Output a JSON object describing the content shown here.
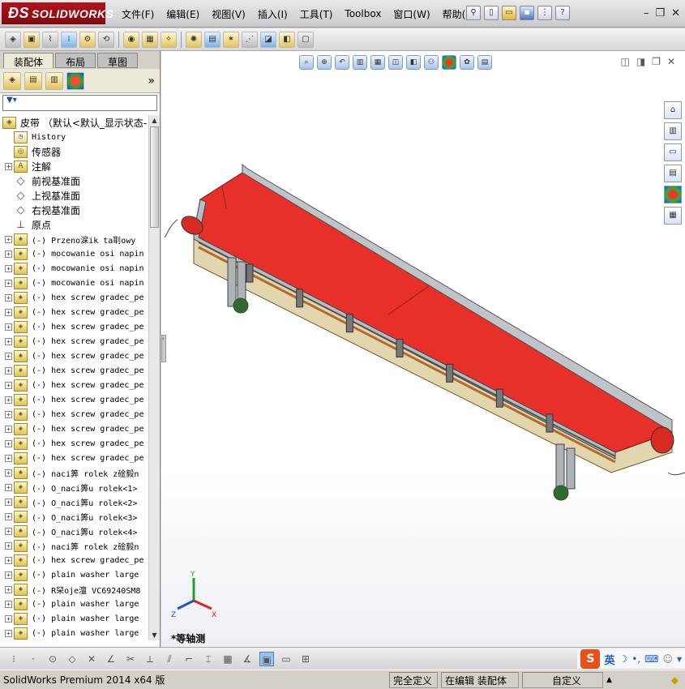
{
  "app": {
    "logo_mark": "ƉS",
    "logo_text": "SOLIDWORKS"
  },
  "menu": [
    "文件(F)",
    "编辑(E)",
    "视图(V)",
    "插入(I)",
    "工具(T)",
    "Toolbox",
    "窗口(W)",
    "帮助(H)"
  ],
  "panel": {
    "tabs": [
      "装配体",
      "布局",
      "草图"
    ],
    "active_tab": "装配体",
    "filter_icon": "funnel-icon",
    "root_label": "皮带 （默认<默认_显示状态-",
    "tree": [
      {
        "label": "History",
        "icon": "history-icon",
        "expand": false
      },
      {
        "label": "传感器",
        "icon": "sensor-icon",
        "expand": false,
        "cjk": true
      },
      {
        "label": "注解",
        "icon": "annotation-icon",
        "expand": true,
        "cjk": true
      },
      {
        "label": "前视基准面",
        "icon": "plane-icon",
        "expand": false,
        "cjk": true
      },
      {
        "label": "上视基准面",
        "icon": "plane-icon",
        "expand": false,
        "cjk": true
      },
      {
        "label": "右视基准面",
        "icon": "plane-icon",
        "expand": false,
        "cjk": true
      },
      {
        "label": "原点",
        "icon": "origin-icon",
        "expand": false,
        "cjk": true
      },
      {
        "label": "(-) Przeno淭ik ta刵owy",
        "icon": "part-icon",
        "expand": true
      },
      {
        "label": "(-) mocowanie osi napin",
        "icon": "part-icon",
        "expand": true
      },
      {
        "label": "(-) mocowanie osi napin",
        "icon": "part-icon",
        "expand": true
      },
      {
        "label": "(-) mocowanie osi napin",
        "icon": "part-icon",
        "expand": true
      },
      {
        "label": "(-) hex screw gradec_pe",
        "icon": "part-icon",
        "expand": true
      },
      {
        "label": "(-) hex screw gradec_pe",
        "icon": "part-icon",
        "expand": true
      },
      {
        "label": "(-) hex screw gradec_pe",
        "icon": "part-icon",
        "expand": true
      },
      {
        "label": "(-) hex screw gradec_pe",
        "icon": "part-icon",
        "expand": true
      },
      {
        "label": "(-) hex screw gradec_pe",
        "icon": "part-icon",
        "expand": true
      },
      {
        "label": "(-) hex screw gradec_pe",
        "icon": "part-icon",
        "expand": true
      },
      {
        "label": "(-) hex screw gradec_pe",
        "icon": "part-icon",
        "expand": true
      },
      {
        "label": "(-) hex screw gradec_pe",
        "icon": "part-icon",
        "expand": true
      },
      {
        "label": "(-) hex screw gradec_pe",
        "icon": "part-icon",
        "expand": true
      },
      {
        "label": "(-) hex screw gradec_pe",
        "icon": "part-icon",
        "expand": true
      },
      {
        "label": "(-) hex screw gradec_pe",
        "icon": "part-icon",
        "expand": true
      },
      {
        "label": "(-) hex screw gradec_pe",
        "icon": "part-icon",
        "expand": true
      },
      {
        "label": "(-) naci筭 rolek z碒毅n",
        "icon": "part-icon",
        "expand": true
      },
      {
        "label": "(-) O_naci筭u rolek<1>",
        "icon": "part-icon",
        "expand": true
      },
      {
        "label": "(-) O_naci筭u rolek<2>",
        "icon": "part-icon",
        "expand": true
      },
      {
        "label": "(-) O_naci筭u rolek<3>",
        "icon": "part-icon",
        "expand": true
      },
      {
        "label": "(-) O_naci筭u rolek<4>",
        "icon": "part-icon",
        "expand": true
      },
      {
        "label": "(-) naci筭 rolek z碒毅n",
        "icon": "part-icon",
        "expand": true
      },
      {
        "label": "(-) hex screw gradec_pe",
        "icon": "part-icon",
        "expand": true
      },
      {
        "label": "(-) plain washer large",
        "icon": "part-icon",
        "expand": true
      },
      {
        "label": "(-) R罙oje澶 VC69240SM8",
        "icon": "part-icon",
        "expand": true
      },
      {
        "label": "(-) plain washer large",
        "icon": "part-icon",
        "expand": true
      },
      {
        "label": "(-) plain washer large",
        "icon": "part-icon",
        "expand": true
      },
      {
        "label": "(-) plain washer large",
        "icon": "part-icon",
        "expand": true
      }
    ]
  },
  "viewport": {
    "view_label": "*等轴测",
    "axis_labels": {
      "x": "X",
      "y": "Y",
      "z": "Z"
    },
    "belt_color": "#e8302a",
    "frame_color": "#e2d6ae"
  },
  "ime": {
    "logo": "S",
    "lang": "英"
  },
  "status": {
    "product": "SolidWorks Premium 2014 x64 版",
    "definition": "完全定义",
    "editing": "在编辑 装配体",
    "custom": "自定义"
  }
}
